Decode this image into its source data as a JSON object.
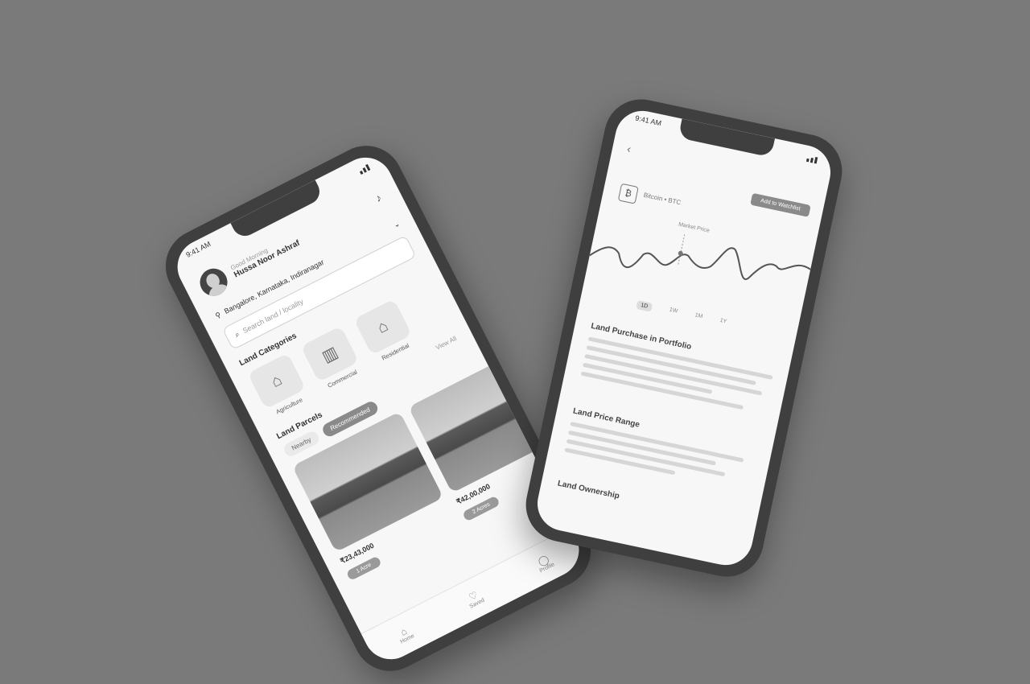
{
  "phone1": {
    "status": {
      "time": "9:41 AM"
    },
    "header": {
      "greeting": "Good Morning",
      "user_name": "Hussa Noor Ashraf"
    },
    "location": {
      "label": "Bangalore, Karnataka, Indiranagar"
    },
    "search": {
      "placeholder": "Search land / locality"
    },
    "categories": {
      "title": "Land Categories",
      "view_all": "View All",
      "items": [
        {
          "label": "Agriculture",
          "icon": "farm-house-icon"
        },
        {
          "label": "Commercial",
          "icon": "building-icon"
        },
        {
          "label": "Residential",
          "icon": "house-icon"
        }
      ]
    },
    "listings": {
      "title": "Land Parcels",
      "filters": [
        {
          "label": "Nearby",
          "active": false
        },
        {
          "label": "Recommended",
          "active": true
        }
      ],
      "cards": [
        {
          "price": "₹23,43,000",
          "tag": "1 Acre"
        },
        {
          "price": "₹42,00,000",
          "tag": "2 Acres"
        }
      ]
    },
    "tabbar": [
      {
        "label": "Home",
        "icon": "home-icon"
      },
      {
        "label": "Saved",
        "icon": "heart-icon"
      },
      {
        "label": "Profile",
        "icon": "user-icon"
      }
    ]
  },
  "phone2": {
    "status": {
      "time": "9:41 AM"
    },
    "top_button": "Add to Watchlist",
    "pair": "Bitcoin • BTC",
    "chart_label": "Market Price",
    "ranges": [
      {
        "label": "1D",
        "active": true
      },
      {
        "label": "1W",
        "active": false
      },
      {
        "label": "1M",
        "active": false
      },
      {
        "label": "1Y",
        "active": false
      }
    ],
    "sections": [
      {
        "title": "Land Purchase in Portfolio"
      },
      {
        "title": "Land Price Range"
      },
      {
        "title": "Land Ownership"
      }
    ]
  }
}
